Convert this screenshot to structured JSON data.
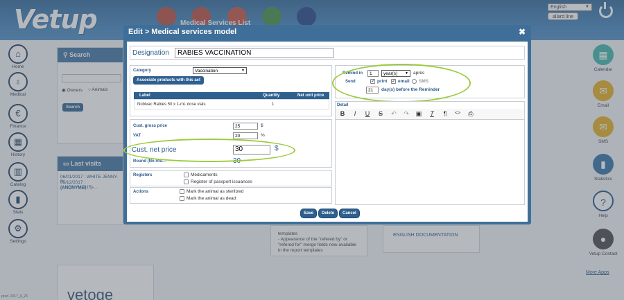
{
  "app": {
    "logo": "Vetup",
    "language": "English",
    "user": "allard line",
    "version": "prod. 2017_6_23"
  },
  "left_nav": [
    "Home",
    "Medical",
    "Finance",
    "History",
    "Catalog",
    "Stats",
    "Settings"
  ],
  "right_nav": [
    "Calendar",
    "Email",
    "SMS",
    "Statistics",
    "Help",
    "Vetup Contact"
  ],
  "more_apps": "More Apps",
  "background": {
    "search_title": "Search",
    "search_filters": [
      "Owners",
      "Animals"
    ],
    "search_button": "Search",
    "last_visits_title": "Last visits",
    "last_visits": [
      "06/01/2017 : WHITE JENNY-P...",
      "05/12/2017 : (ANONYMOUS)-...",
      "(ANONYME)"
    ],
    "news_text": [
      "templates",
      "- Appearance of the \"refered by\" or",
      "\"refered for\" merge fields now available",
      "in the report templates"
    ],
    "doc_link": "ENGLISH DOCUMENTATION",
    "logo_bottom": "vetoge",
    "behind_title": "Medical Services List"
  },
  "modal": {
    "title": "Edit > Medical services model",
    "designation_label": "Designation",
    "designation_value": "RABIES VACCINATION",
    "category_label": "Category",
    "category_value": "Vaccination",
    "associate_button": "Associate products with this act",
    "table_headers": [
      "Label",
      "Quantity",
      "Net unit price"
    ],
    "table_rows": [
      {
        "label": "Nobivac Rabies 50 x 1-mL dose vials",
        "quantity": "1",
        "price": ""
      }
    ],
    "gross_price_label": "Cust. gross price",
    "gross_price_value": "25",
    "gross_price_unit": "$",
    "vat_label": "VAT",
    "vat_value": "20",
    "vat_unit": "%",
    "net_price_label": "Cust. net price",
    "net_price_value": "30",
    "net_price_unit": "$",
    "round_label": "Round (No rou...",
    "round_value": "30",
    "registers_label": "Registers",
    "registers": [
      "Médicaments",
      "Register of passport issuances"
    ],
    "actions_label": "Actions",
    "actions": [
      "Mark the animal as sterilized",
      "Mark the animal as dead"
    ],
    "remind_in_label": "Remind in",
    "remind_in_value": "1",
    "remind_unit": "year(s)",
    "remind_suffix": "après",
    "send_label": "Send",
    "send_options": [
      "print",
      "email",
      "SMS"
    ],
    "days_value": "21",
    "days_suffix": "day(s) before the Reminder",
    "detail_label": "Detail",
    "buttons": {
      "save": "Save",
      "delete": "Delete",
      "cancel": "Cancel"
    }
  },
  "colors": {
    "modal": "#3f6f99",
    "highlight": "#9ccc3c",
    "header": "#2c6496"
  }
}
